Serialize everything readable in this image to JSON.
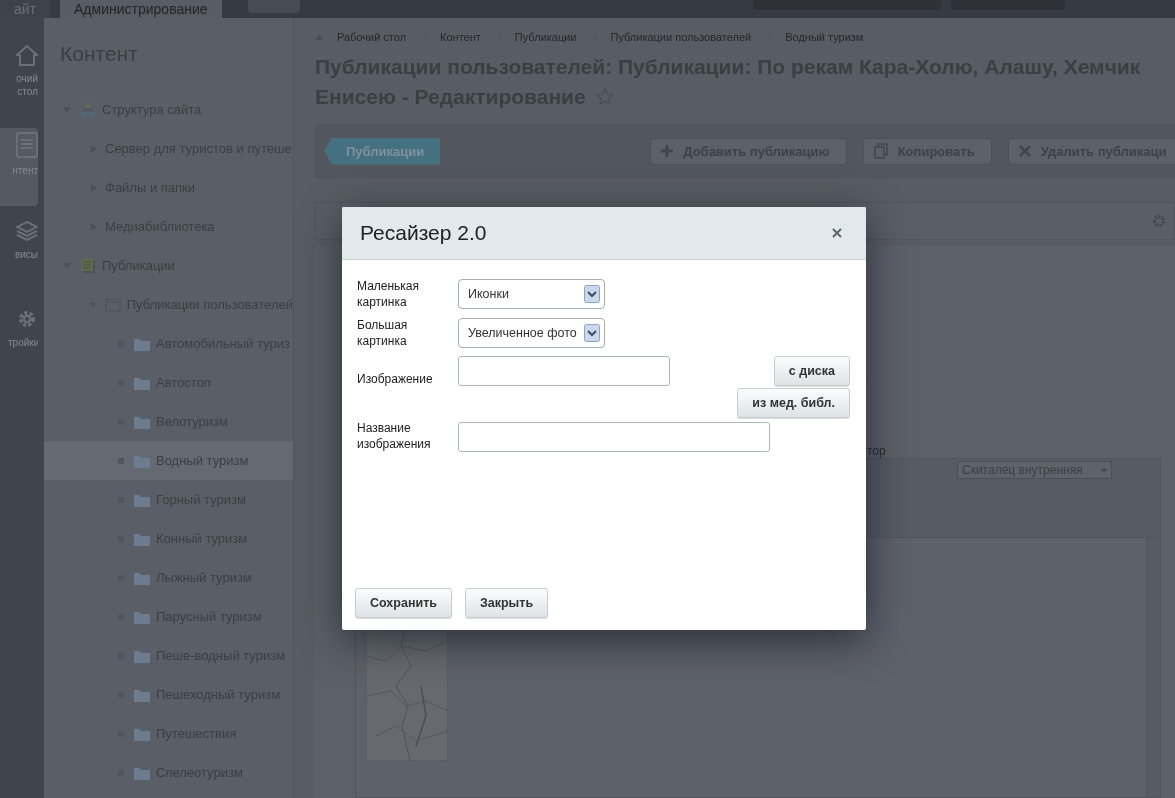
{
  "top_bar": {
    "tabs": [
      {
        "label": "айт",
        "selected": false
      },
      {
        "label": "Администрирование",
        "selected": true
      }
    ]
  },
  "rail": [
    {
      "label": "очий стол",
      "kind": "home",
      "selected": false
    },
    {
      "label": "нтент",
      "kind": "content",
      "selected": true
    },
    {
      "label": "висы",
      "kind": "services",
      "selected": false
    },
    {
      "label": "тройки",
      "kind": "settings",
      "selected": false
    }
  ],
  "tree": {
    "title": "Контент",
    "items": [
      {
        "label": "Структура сайта",
        "kind": "site",
        "expanded": true,
        "children": [
          {
            "label": "Сервер для туристов и путеше",
            "kind": "plain",
            "expanded": false
          },
          {
            "label": "Файлы и папки",
            "kind": "plain",
            "expanded": false
          },
          {
            "label": "Медиабиблиотека",
            "kind": "plain",
            "expanded": false
          }
        ]
      },
      {
        "label": "Публикации",
        "kind": "iblock-type",
        "expanded": true,
        "children": [
          {
            "label": "Публикации пользователей",
            "kind": "iblock",
            "expanded": true,
            "children": [
              {
                "label": "Автомобильный туриз",
                "kind": "folder",
                "selected": false
              },
              {
                "label": "Автостоп",
                "kind": "folder",
                "selected": false
              },
              {
                "label": "Велотуризм",
                "kind": "folder",
                "selected": false
              },
              {
                "label": "Водный туризм",
                "kind": "folder",
                "selected": true
              },
              {
                "label": "Горный туризм",
                "kind": "folder",
                "selected": false
              },
              {
                "label": "Конный туризм",
                "kind": "folder",
                "selected": false
              },
              {
                "label": "Лыжный туризм",
                "kind": "folder",
                "selected": false
              },
              {
                "label": "Парусный туризм",
                "kind": "folder",
                "selected": false
              },
              {
                "label": "Пеше-водный туризм",
                "kind": "folder",
                "selected": false
              },
              {
                "label": "Пешеходный туризм",
                "kind": "folder",
                "selected": false
              },
              {
                "label": "Путешествия",
                "kind": "folder",
                "selected": false
              },
              {
                "label": "Спелеотуризм",
                "kind": "folder",
                "selected": false
              }
            ]
          }
        ]
      }
    ]
  },
  "breadcrumbs": [
    "Рабочий стол",
    "Контент",
    "Публикации",
    "Публикации пользователей",
    "Водный туризм"
  ],
  "page_title": {
    "lines": [
      "Публикации пользователей: Публикации: По рекам Кара-Холю, Алашу, Хемчик",
      "Енисею - Редактирование"
    ]
  },
  "toolbar": {
    "section": "Публикации",
    "buttons": [
      {
        "label": "Добавить публикацию",
        "kind": "add"
      },
      {
        "label": "Копировать",
        "kind": "copy"
      },
      {
        "label": "Удалить публикаци",
        "kind": "delete"
      }
    ]
  },
  "editor": {
    "label": "тор",
    "template": "Скиталец внутренняя"
  },
  "dialog": {
    "title": "Ресайзер 2.0",
    "fields": [
      {
        "label": "Маленькая картинка",
        "kind": "select",
        "value": "Иконки"
      },
      {
        "label": "Большая картинка",
        "kind": "select",
        "value": "Увеличенное фото"
      },
      {
        "label": "Изображение",
        "kind": "file",
        "buttons": [
          "с диска",
          "из мед. библ."
        ]
      },
      {
        "label": "Название изображения",
        "kind": "text"
      }
    ],
    "buttons": [
      "Сохранить",
      "Закрыть"
    ]
  }
}
